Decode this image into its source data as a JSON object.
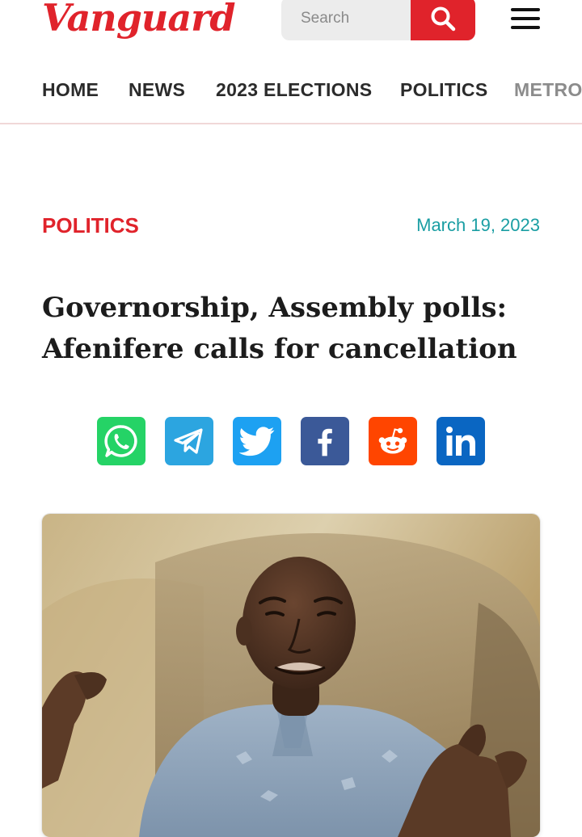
{
  "site": {
    "logo_text": "Vanguard",
    "brand_color": "#e0232b"
  },
  "search": {
    "placeholder": "Search",
    "icon": "search-icon"
  },
  "menu": {
    "icon": "hamburger-menu-icon"
  },
  "nav": {
    "items": [
      "HOME",
      "NEWS",
      "2023 ELECTIONS",
      "POLITICS",
      "METRO"
    ]
  },
  "article": {
    "category": "POLITICS",
    "date": "March 19, 2023",
    "headline": "Governorship, Assembly polls: Afenifere calls for cancellation"
  },
  "share": {
    "buttons": [
      {
        "name": "whatsapp",
        "icon": "whatsapp-icon",
        "color": "#25d366"
      },
      {
        "name": "telegram",
        "icon": "telegram-icon",
        "color": "#2ca5e0"
      },
      {
        "name": "twitter",
        "icon": "twitter-icon",
        "color": "#1da1f2"
      },
      {
        "name": "facebook",
        "icon": "facebook-icon",
        "color": "#3b5998"
      },
      {
        "name": "reddit",
        "icon": "reddit-icon",
        "color": "#ff4500"
      },
      {
        "name": "linkedin",
        "icon": "linkedin-icon",
        "color": "#0a66c2"
      }
    ]
  },
  "colors": {
    "accent_red": "#e0232b",
    "date_teal": "#1a9ea3"
  }
}
